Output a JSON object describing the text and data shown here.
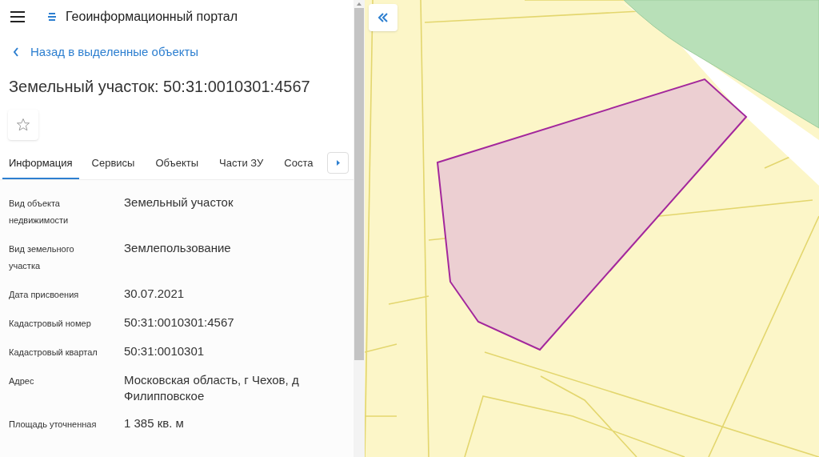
{
  "header": {
    "title": "Геоинформационный портал"
  },
  "back_link": "Назад в выделенные объекты",
  "object_title": "Земельный участок: 50:31:0010301:4567",
  "favorite": {
    "on": false
  },
  "tabs": [
    {
      "label": "Информация",
      "selected": true
    },
    {
      "label": "Сервисы",
      "selected": false
    },
    {
      "label": "Объекты",
      "selected": false
    },
    {
      "label": "Части ЗУ",
      "selected": false
    },
    {
      "label": "Соста",
      "selected": false
    }
  ],
  "properties": [
    {
      "label": "Вид объекта недвижимости",
      "value": "Земельный участок"
    },
    {
      "label": "Вид земельного участка",
      "value": "Землепользование"
    },
    {
      "label": "Дата присвоения",
      "value": "30.07.2021"
    },
    {
      "label": "Кадастровый номер",
      "value": "50:31:0010301:4567"
    },
    {
      "label": "Кадастровый квартал",
      "value": "50:31:0010301"
    },
    {
      "label": "Адрес",
      "value": "Московская область, г Чехов, д Филипповское"
    },
    {
      "label": "Площадь уточненная",
      "value": "1 385 кв. м"
    }
  ]
}
